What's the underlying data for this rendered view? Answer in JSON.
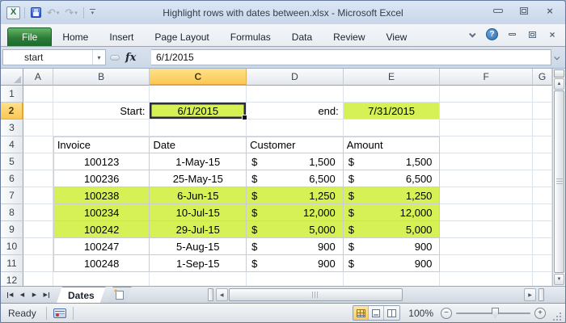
{
  "window": {
    "title": "Highlight rows with dates between.xlsx  -  Microsoft Excel"
  },
  "icons": {
    "excel_logo": "X",
    "undo": "↶",
    "redo": "↷",
    "dropdown": "▾",
    "help": "?",
    "close": "×",
    "scroll_up": "▲",
    "scroll_down": "▼",
    "scroll_left": "◀",
    "scroll_right": "▶",
    "nav_prev": "◀",
    "nav_next": "▶",
    "zoom_out": "−",
    "zoom_in": "+"
  },
  "ribbon": {
    "tabs": [
      {
        "label": "File",
        "active": true,
        "file": true
      },
      {
        "label": "Home"
      },
      {
        "label": "Insert"
      },
      {
        "label": "Page Layout"
      },
      {
        "label": "Formulas"
      },
      {
        "label": "Data"
      },
      {
        "label": "Review"
      },
      {
        "label": "View"
      }
    ]
  },
  "formula_bar": {
    "name_box": "start",
    "fx_label": "fx",
    "formula": "6/1/2015"
  },
  "grid": {
    "column_headers": [
      "A",
      "B",
      "C",
      "D",
      "E",
      "F",
      "G"
    ],
    "selected_column": "C",
    "row_headers": [
      "1",
      "2",
      "3",
      "4",
      "5",
      "6",
      "7",
      "8",
      "9",
      "10",
      "11",
      "12"
    ],
    "selected_row": "2",
    "cells": {
      "start_label": "Start:",
      "start_value": "6/1/2015",
      "end_label": "end:",
      "end_value": "7/31/2015"
    },
    "table": {
      "headers": [
        "Invoice",
        "Date",
        "Customer",
        "Amount"
      ],
      "currency": "$",
      "rows": [
        {
          "invoice": "100123",
          "date": "1-May-15",
          "customer": "1,500",
          "amount": "1,500",
          "highlighted": false
        },
        {
          "invoice": "100236",
          "date": "25-May-15",
          "customer": "6,500",
          "amount": "6,500",
          "highlighted": false
        },
        {
          "invoice": "100238",
          "date": "6-Jun-15",
          "customer": "1,250",
          "amount": "1,250",
          "highlighted": true
        },
        {
          "invoice": "100234",
          "date": "10-Jul-15",
          "customer": "12,000",
          "amount": "12,000",
          "highlighted": true
        },
        {
          "invoice": "100242",
          "date": "29-Jul-15",
          "customer": "5,000",
          "amount": "5,000",
          "highlighted": true
        },
        {
          "invoice": "100247",
          "date": "5-Aug-15",
          "customer": "900",
          "amount": "900",
          "highlighted": false
        },
        {
          "invoice": "100248",
          "date": "1-Sep-15",
          "customer": "900",
          "amount": "900",
          "highlighted": false
        }
      ]
    }
  },
  "sheet_bar": {
    "tabs": [
      {
        "label": "Dates",
        "active": true
      }
    ]
  },
  "status_bar": {
    "mode": "Ready",
    "zoom_level": "100%"
  },
  "colors": {
    "highlight_green": "#d6f155",
    "selected_header_amber": "#fbc852",
    "file_tab_green": "#2d7d39",
    "selection_border": "#2b2b40"
  }
}
